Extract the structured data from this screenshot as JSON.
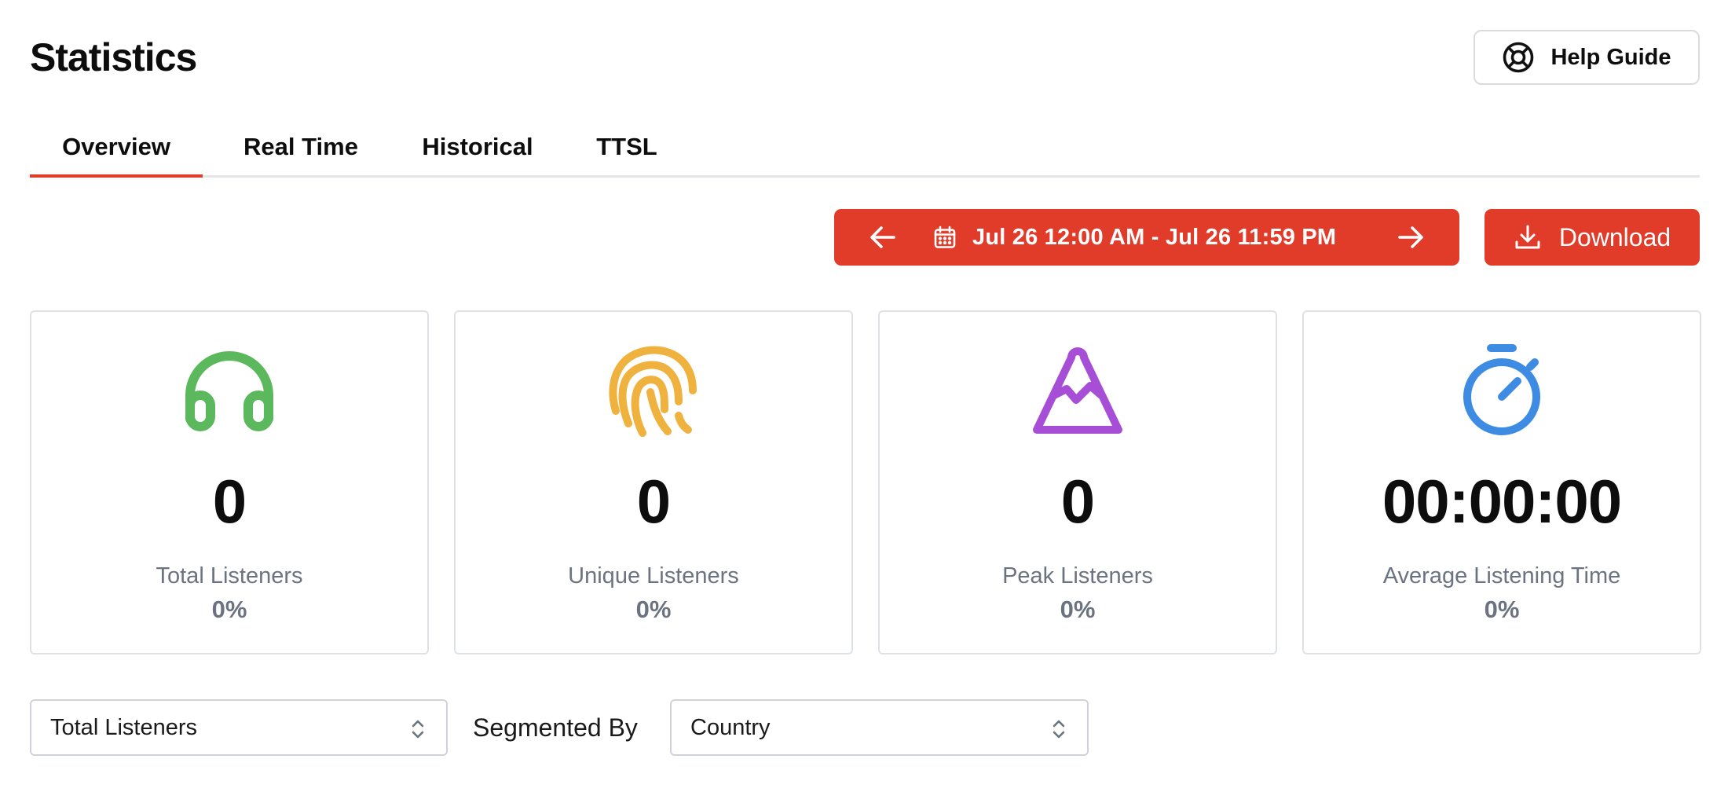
{
  "header": {
    "title": "Statistics",
    "help_label": "Help Guide"
  },
  "tabs": [
    {
      "label": "Overview",
      "active": true
    },
    {
      "label": "Real Time",
      "active": false
    },
    {
      "label": "Historical",
      "active": false
    },
    {
      "label": "TTSL",
      "active": false
    }
  ],
  "toolbar": {
    "date_range": "Jul 26 12:00 AM - Jul 26 11:59 PM",
    "download_label": "Download"
  },
  "cards": [
    {
      "icon": "headphones-icon",
      "color": "#5cb85c",
      "value": "0",
      "label": "Total Listeners",
      "change": "0%"
    },
    {
      "icon": "fingerprint-icon",
      "color": "#f0b23e",
      "value": "0",
      "label": "Unique Listeners",
      "change": "0%"
    },
    {
      "icon": "mountain-icon",
      "color": "#a64fd6",
      "value": "0",
      "label": "Peak Listeners",
      "change": "0%"
    },
    {
      "icon": "stopwatch-icon",
      "color": "#3d8be2",
      "value": "00:00:00",
      "label": "Average Listening Time",
      "change": "0%"
    }
  ],
  "filters": {
    "metric_value": "Total Listeners",
    "segmented_by_label": "Segmented By",
    "segment_value": "Country"
  },
  "colors": {
    "accent": "#e13b2a",
    "border": "#dfe2e5",
    "muted_text": "#6b7280"
  }
}
